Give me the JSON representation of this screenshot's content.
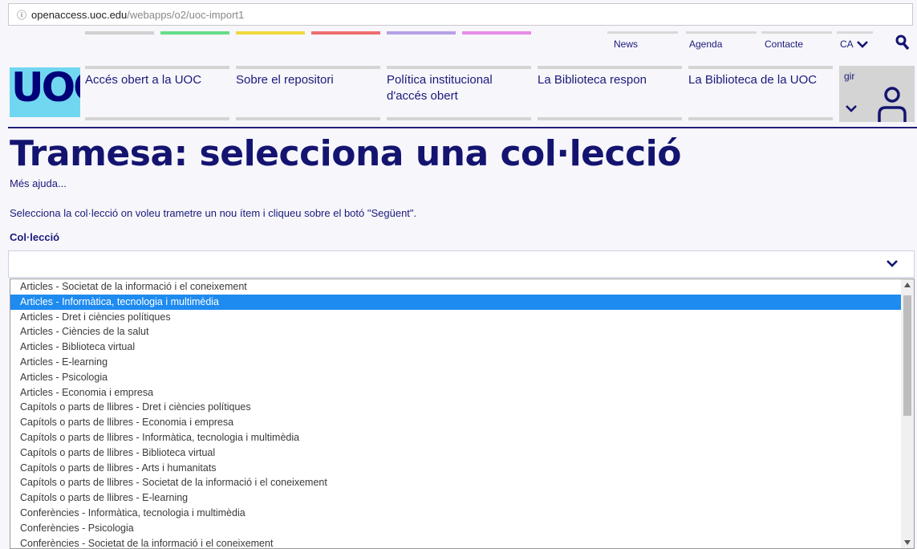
{
  "browser": {
    "url_host": "openaccess.uoc.edu",
    "url_path": "/webapps/o2/uoc-import1"
  },
  "header": {
    "utility": {
      "news": "News",
      "agenda": "Agenda",
      "contact": "Contacte",
      "lang": "CA"
    },
    "logo_text": "UOC",
    "nav": [
      {
        "label": "Accés obert a la UOC"
      },
      {
        "label": "Sobre el repositori"
      },
      {
        "label": "Política institucional d'accés obert"
      },
      {
        "label": "La Biblioteca respon"
      },
      {
        "label": "La Biblioteca de la UOC"
      }
    ],
    "gir": "gir"
  },
  "page": {
    "title": "Tramesa: selecciona una col·lecció",
    "help_link": "Més ajuda...",
    "instructions": "Selecciona la col·lecció on voleu trametre un nou ítem i cliqueu sobre el botó \"Següent\".",
    "field_label": "Col·lecció"
  },
  "collections": [
    {
      "label": "Articles - Societat de la informació i el coneixement"
    },
    {
      "label": "Articles - Informàtica, tecnologia i multimèdia"
    },
    {
      "label": "Articles - Dret i ciències polítiques"
    },
    {
      "label": "Articles - Ciències de la salut"
    },
    {
      "label": "Articles - Biblioteca virtual"
    },
    {
      "label": "Articles - E-learning"
    },
    {
      "label": "Articles - Psicologia"
    },
    {
      "label": "Articles - Economia i empresa"
    },
    {
      "label": "Capítols o parts de llibres - Dret i ciències polítiques"
    },
    {
      "label": "Capítols o parts de llibres - Economia i empresa"
    },
    {
      "label": "Capítols o parts de llibres - Informàtica, tecnologia i multimèdia"
    },
    {
      "label": "Capítols o parts de llibres - Biblioteca virtual"
    },
    {
      "label": "Capítols o parts de llibres - Arts i humanitats"
    },
    {
      "label": "Capítols o parts de llibres - Societat de la informació i el coneixement"
    },
    {
      "label": "Capítols o parts de llibres - E-learning"
    },
    {
      "label": "Conferències - Informàtica, tecnologia i multimèdia"
    },
    {
      "label": "Conferències - Psicologia"
    },
    {
      "label": "Conferències - Societat de la informació i el coneixement"
    }
  ],
  "selected_collection": "Articles - Informàtica, tecnologia i multimèdia",
  "colors": {
    "strip": [
      "#d0d0d0",
      "#66dd88",
      "#f0d83c",
      "#ee6e6e",
      "#b6a0e8",
      "#e88ae8"
    ],
    "brand_navy": "#141470",
    "logo_bg": "#71d7f0",
    "selection": "#1e8bf0"
  }
}
